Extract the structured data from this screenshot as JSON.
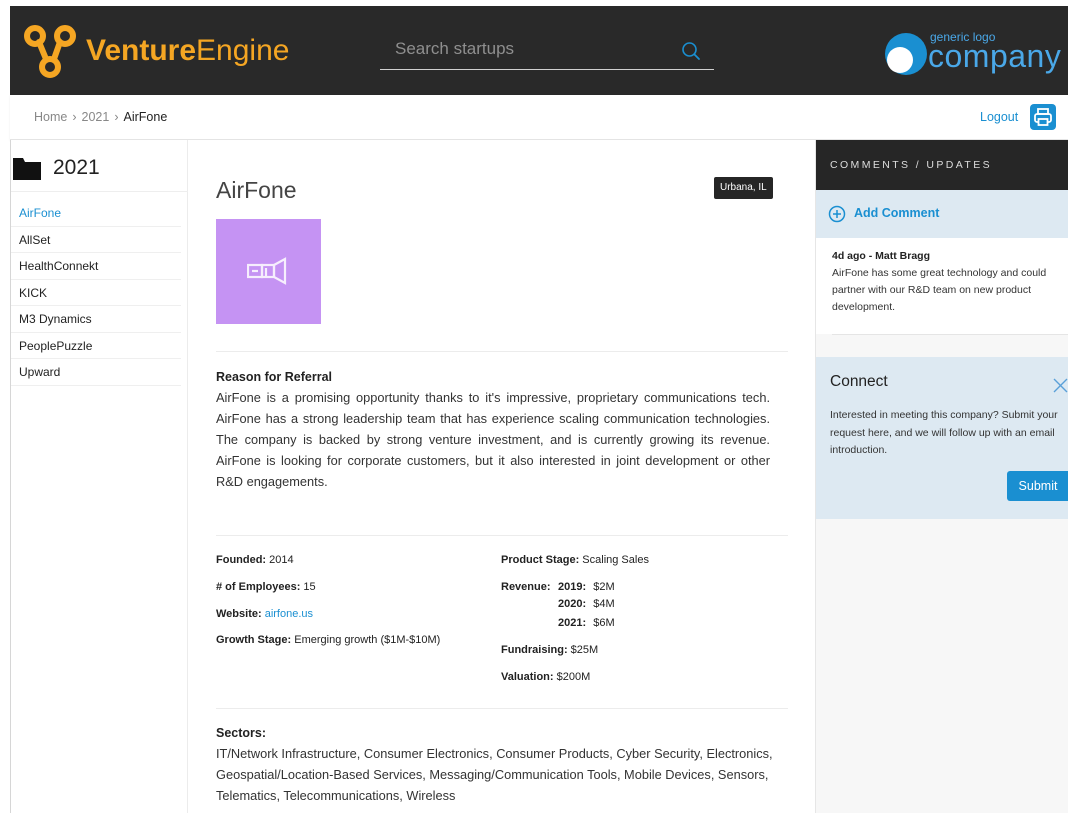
{
  "header": {
    "brand_bold": "Venture",
    "brand_light": "Engine",
    "search_placeholder": "Search startups",
    "company_logo_small": "generic logo",
    "company_logo_big": "company",
    "colors": {
      "bar": "#292929",
      "brand": "#f5a623",
      "accent": "#1a8fd1"
    }
  },
  "breadcrumb": {
    "items": [
      "Home",
      "2021",
      "AirFone"
    ],
    "separator": "›"
  },
  "topactions": {
    "logout_label": "Logout",
    "print_icon": "printer-icon"
  },
  "sidebar": {
    "folder_icon": "folder-icon",
    "title": "2021",
    "items": [
      {
        "label": "AirFone",
        "active": true
      },
      {
        "label": "AllSet"
      },
      {
        "label": "HealthConnekt"
      },
      {
        "label": "KICK"
      },
      {
        "label": "M3 Dynamics"
      },
      {
        "label": "PeoplePuzzle"
      },
      {
        "label": "Upward"
      }
    ]
  },
  "main": {
    "title": "AirFone",
    "location": "Urbana, IL",
    "image_icon": "megaphone-icon",
    "image_color": "#c593f3",
    "referral": {
      "heading": "Reason for Referral",
      "text": "AirFone is a promising opportunity thanks to it's impressive, proprietary communications tech. AirFone has a strong leadership team that has experience scaling communication technologies. The company is backed by strong venture investment, and is currently growing its revenue. AirFone is looking for corporate customers, but it also interested in joint development or other R&D engagements."
    },
    "facts": {
      "founded_label": "Founded:",
      "founded": "2014",
      "employees_label": "# of Employees:",
      "employees": "15",
      "website_label": "Website:",
      "website": "airfone.us",
      "growth_label": "Growth Stage:",
      "growth": "Emerging growth ($1M-$10M)",
      "product_label": "Product Stage:",
      "product": "Scaling Sales",
      "revenue_label": "Revenue:",
      "revenue": [
        {
          "year": "2019:",
          "value": "$2M"
        },
        {
          "year": "2020:",
          "value": "$4M"
        },
        {
          "year": "2021:",
          "value": "$6M"
        }
      ],
      "fundraising_label": "Fundraising:",
      "fundraising": "$25M",
      "valuation_label": "Valuation:",
      "valuation": "$200M"
    },
    "sectors": {
      "heading": "Sectors:",
      "text": "IT/Network Infrastructure, Consumer Electronics, Consumer Products, Cyber Security, Electronics, Geospatial/Location-Based Services, Messaging/Communication Tools, Mobile Devices, Sensors, Telematics, Telecommunications, Wireless"
    }
  },
  "comments": {
    "heading": "COMMENTS / UPDATES",
    "add_label": "Add Comment",
    "entries": [
      {
        "author": "4d ago - Matt Bragg",
        "text": "AirFone has some great technology and could partner with our R&D team on new product development."
      }
    ]
  },
  "connect": {
    "title": "Connect",
    "text": "Interested in meeting this company? Submit your request here, and we will follow up with an email introduction.",
    "submit_label": "Submit"
  }
}
